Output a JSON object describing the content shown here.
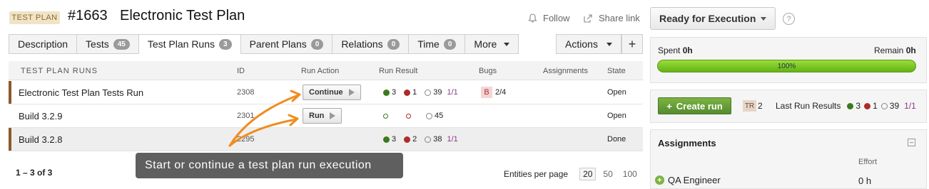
{
  "header": {
    "entity_type": "TEST PLAN",
    "entity_id": "#1663",
    "title": "Electronic Test Plan",
    "follow_label": "Follow",
    "share_label": "Share link",
    "state_value": "Ready for Execution",
    "help_glyph": "?"
  },
  "tabs": [
    {
      "label": "Description",
      "count": null
    },
    {
      "label": "Tests",
      "count": "45"
    },
    {
      "label": "Test Plan Runs",
      "count": "3"
    },
    {
      "label": "Parent Plans",
      "count": "0"
    },
    {
      "label": "Relations",
      "count": "0"
    },
    {
      "label": "Time",
      "count": "0"
    },
    {
      "label": "More",
      "count": null
    }
  ],
  "actions_label": "Actions",
  "add_glyph": "+",
  "table": {
    "columns": [
      "TEST PLAN RUNS",
      "ID",
      "Run Action",
      "Run Result",
      "Bugs",
      "Assignments",
      "State"
    ],
    "rows": [
      {
        "name": "Electronic Test Plan Tests Run",
        "id": "2308",
        "action": "Continue",
        "passed": "3",
        "failed": "1",
        "notrun": "39",
        "blocked": "1/1",
        "bug_badge": "B",
        "bugs": "2/4",
        "state": "Open"
      },
      {
        "name": "Build 3.2.9",
        "id": "2301",
        "action": "Run",
        "passed": "",
        "failed": "",
        "notrun": "45",
        "blocked": "",
        "bug_badge": "",
        "bugs": "",
        "state": "Open"
      },
      {
        "name": "Build 3.2.8",
        "id": "2295",
        "action": "",
        "passed": "3",
        "failed": "2",
        "notrun": "38",
        "blocked": "1/1",
        "bug_badge": "",
        "bugs": "",
        "state": "Done"
      }
    ]
  },
  "footer": {
    "range": "1 – 3 of 3",
    "per_page_label": "Entities per page",
    "per_page_options": [
      "20",
      "50",
      "100"
    ],
    "per_page_selected": "20"
  },
  "tooltip": "Start or continue a test plan run execution",
  "right_panel": {
    "spent_label": "Spent",
    "spent_value": "0h",
    "remain_label": "Remain",
    "remain_value": "0h",
    "progress_text": "100%",
    "progress_fraction": 1.0,
    "create_run_label": "Create run",
    "tr_badge": "TR",
    "tr_count": "2",
    "last_results_label": "Last Run Results",
    "last_passed": "3",
    "last_failed": "1",
    "last_notrun": "39",
    "last_blocked": "1/1",
    "assignments_title": "Assignments",
    "effort_header": "Effort",
    "role": "QA Engineer",
    "role_effort": "0 h"
  },
  "colors": {
    "accent_brown": "#8b5a2b",
    "pass_green": "#3a7a1c",
    "fail_red": "#b02a2a",
    "progress_green": "#7cc42a",
    "tooltip_bg": "#5f5f5f",
    "arrow_orange": "#f08c1e"
  }
}
